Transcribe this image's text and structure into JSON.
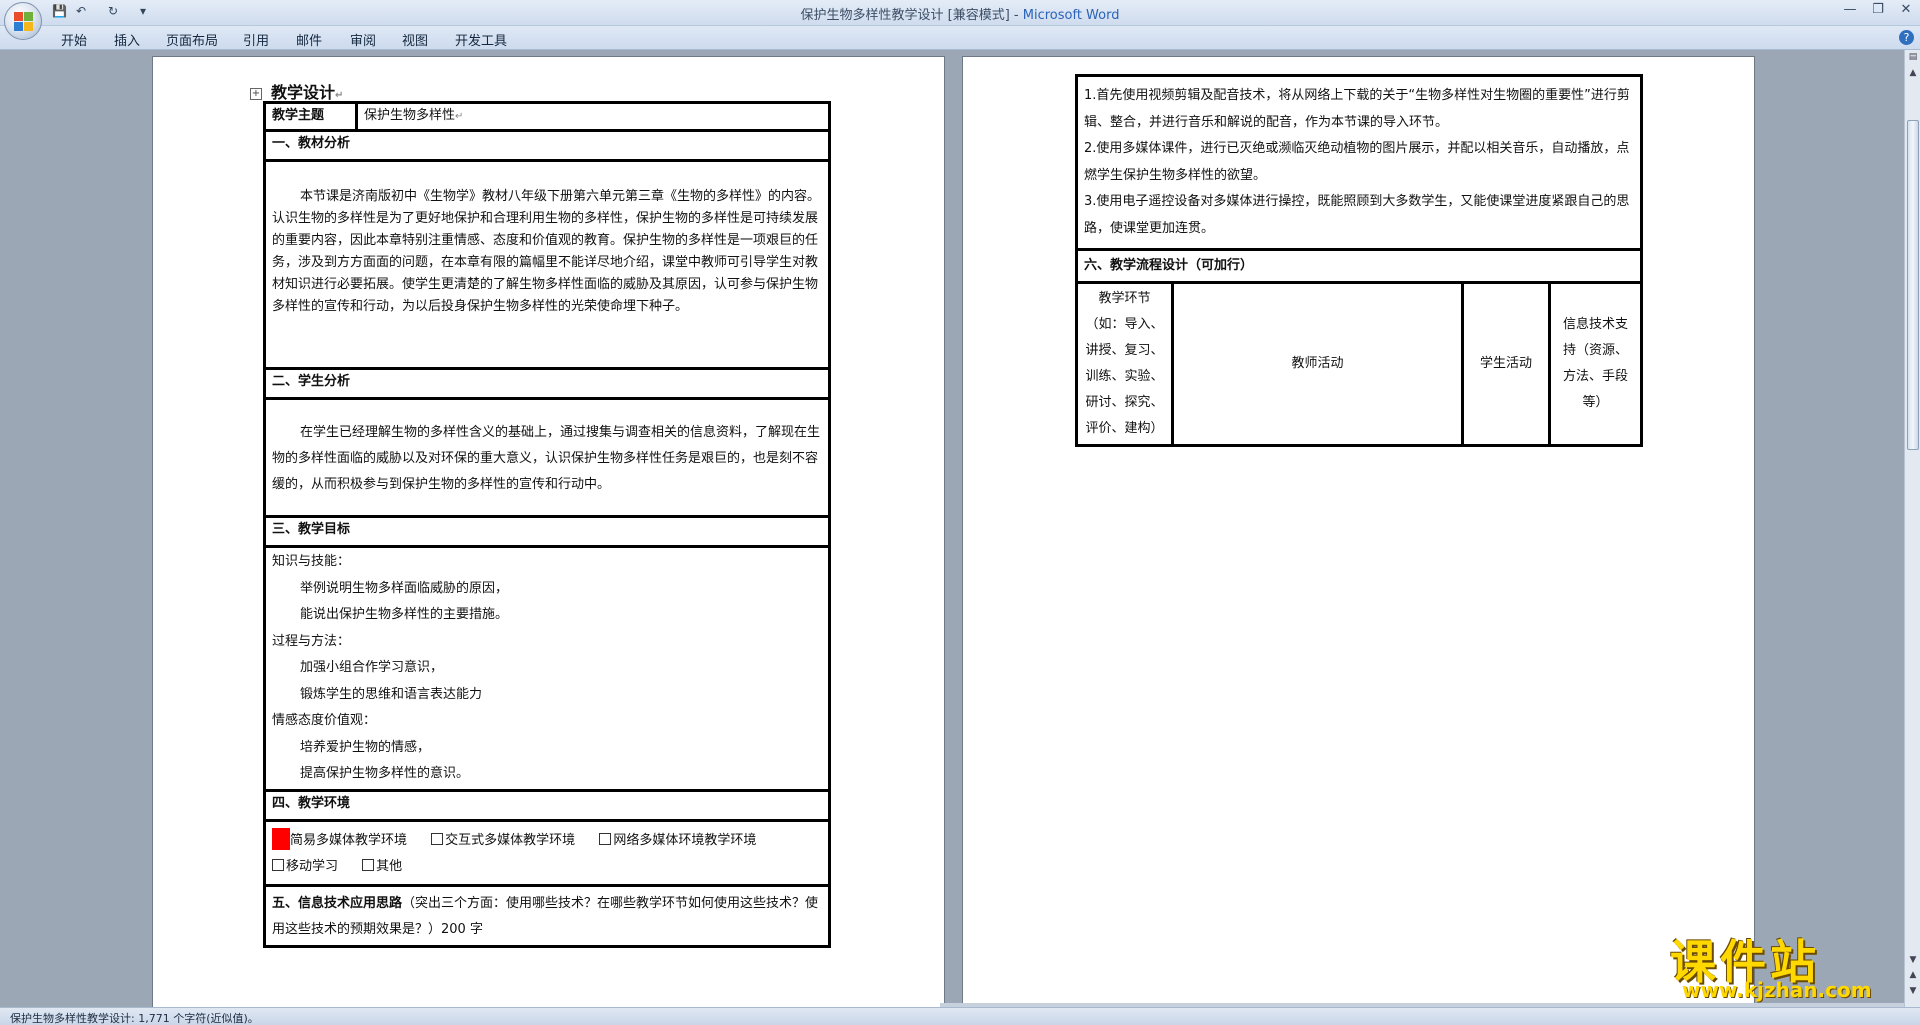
{
  "window": {
    "title_doc": "保护生物多样性教学设计 [兼容模式]",
    "title_sep": " - ",
    "title_app": "Microsoft Word"
  },
  "ribbon": {
    "tabs": [
      "开始",
      "插入",
      "页面布局",
      "引用",
      "邮件",
      "审阅",
      "视图",
      "开发工具"
    ]
  },
  "page1": {
    "heading": "教学设计",
    "topic_label": "教学主题",
    "topic_value": "保护生物多样性",
    "sec1_title": "一、教材分析",
    "sec1_text": "本节课是济南版初中《生物学》教材八年级下册第六单元第三章《生物的多样性》的内容。认识生物的多样性是为了更好地保护和合理利用生物的多样性，保护生物的多样性是可持续发展的重要内容，因此本章特别注重情感、态度和价值观的教育。保护生物的多样性是一项艰巨的任务，涉及到方方面面的问题，在本章有限的篇幅里不能详尽地介绍，课堂中教师可引导学生对教材知识进行必要拓展。使学生更清楚的了解生物多样性面临的威胁及其原因，认可参与保护生物多样性的宣传和行动，为以后投身保护生物多样性的光荣使命埋下种子。",
    "sec2_title": "二、学生分析",
    "sec2_text": "在学生已经理解生物的多样性含义的基础上，通过搜集与调查相关的信息资料，了解现在生物的多样性面临的威胁以及对环保的重大意义，认识保护生物多样性任务是艰巨的，也是刻不容缓的，从而积极参与到保护生物的多样性的宣传和行动中。",
    "sec3_title": "三、教学目标",
    "goals": [
      {
        "text": "知识与技能：",
        "indent": false
      },
      {
        "text": "举例说明生物多样面临威胁的原因，",
        "indent": true
      },
      {
        "text": "能说出保护生物多样性的主要措施。",
        "indent": true
      },
      {
        "text": "过程与方法：",
        "indent": false
      },
      {
        "text": "加强小组合作学习意识，",
        "indent": true
      },
      {
        "text": "锻炼学生的思维和语言表达能力",
        "indent": true
      },
      {
        "text": "情感态度价值观：",
        "indent": false
      },
      {
        "text": "培养爱护生物的情感，",
        "indent": true
      },
      {
        "text": "提高保护生物多样性的意识。",
        "indent": true
      }
    ],
    "sec4_title": "四、教学环境",
    "env_options": [
      "简易多媒体教学环境",
      "交互式多媒体教学环境",
      "网络多媒体环境教学环境",
      "移动学习",
      "其他"
    ],
    "sec5_title": "五、信息技术应用思路",
    "sec5_hint": "（突出三个方面：使用哪些技术？在哪些教学环节如何使用这些技术？使用这些技术的预期效果是？）200 字"
  },
  "page2": {
    "items": [
      "1.首先使用视频剪辑及配音技术，将从网络上下载的关于“生物多样性对生物圈的重要性”进行剪辑、整合，并进行音乐和解说的配音，作为本节课的导入环节。",
      "2.使用多媒体课件，进行已灭绝或濒临灭绝动植物的图片展示，并配以相关音乐，自动播放，点燃学生保护生物多样性的欲望。",
      "3.使用电子遥控设备对多媒体进行操控，既能照顾到大多数学生，又能使课堂进度紧跟自己的思路，使课堂更加连贯。"
    ],
    "sec6_title": "六、教学流程设计（可加行）",
    "col_stage": "教学环节（如：导入、讲授、复习、训练、实验、研讨、探究、评价、建构）",
    "col_teacher": "教师活动",
    "col_student": "学生活动",
    "col_it": "信息技术支持（资源、方法、手段等）"
  },
  "status": {
    "text": "保护生物多样性教学设计: 1,771 个字符(近似值)。"
  },
  "watermark": {
    "title": "课件站",
    "url": "www.kjzhan.com"
  },
  "colors": {
    "checkbox_selected": "#ff0000",
    "watermark": "#ffd800",
    "title_app": "#2a63b8"
  }
}
